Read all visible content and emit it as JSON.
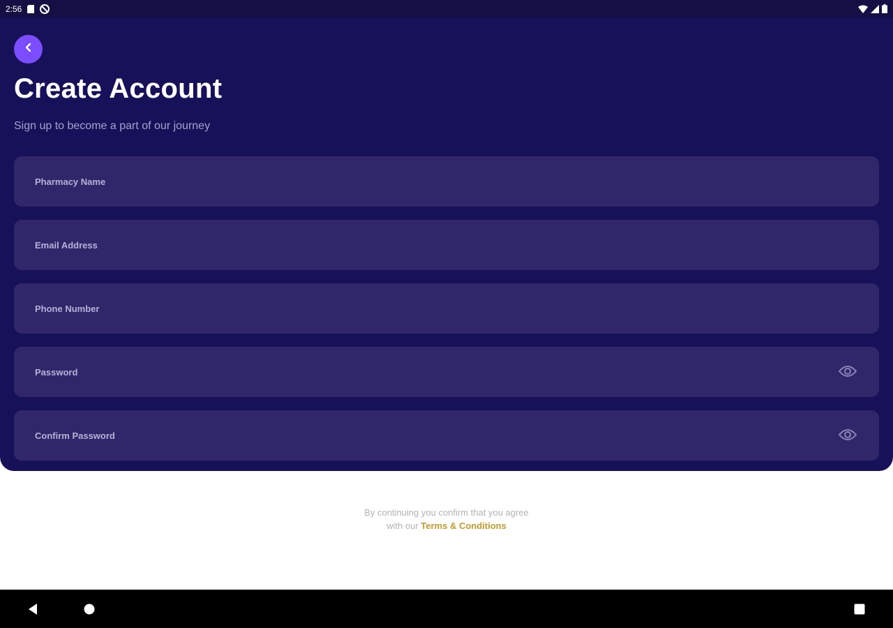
{
  "status_bar": {
    "time": "2:56"
  },
  "header": {
    "title": "Create Account",
    "subtitle": "Sign up to become a part of our journey"
  },
  "form": {
    "pharmacy_name": {
      "placeholder": "Pharmacy Name",
      "value": ""
    },
    "email": {
      "placeholder": "Email Address",
      "value": ""
    },
    "phone": {
      "placeholder": "Phone Number",
      "value": ""
    },
    "password": {
      "placeholder": "Password",
      "value": ""
    },
    "confirm_password": {
      "placeholder": "Confirm Password",
      "value": ""
    }
  },
  "footer": {
    "line1": "By continuing you confirm that you agree",
    "line2_prefix": "with our",
    "terms_link": "Terms & Conditions"
  },
  "icons": {
    "back": "chevron-left-icon",
    "password_toggle": "eye-icon",
    "nav_back": "triangle-back-icon",
    "nav_home": "circle-home-icon",
    "nav_recents": "square-recents-icon"
  },
  "colors": {
    "panel_bg": "#17115a",
    "field_bg": "#30276a",
    "accent": "#7b4dff",
    "link": "#c39a2d"
  }
}
